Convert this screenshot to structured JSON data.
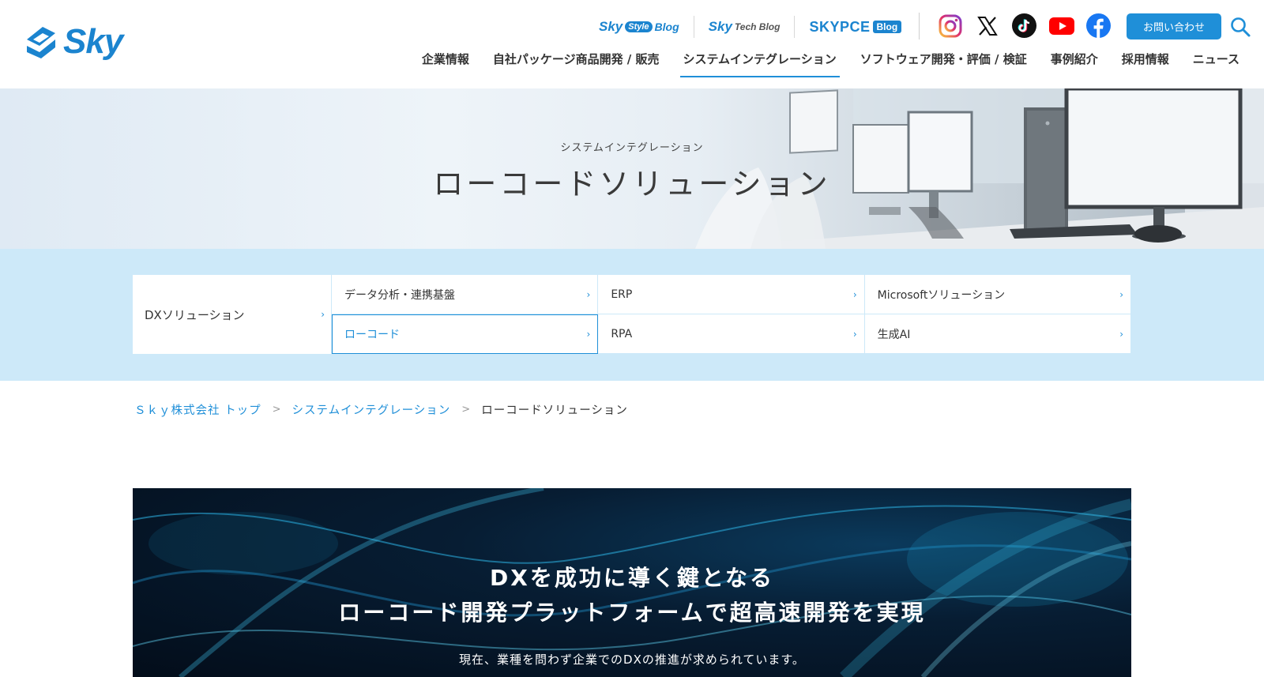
{
  "header": {
    "logo_text": "Sky",
    "blogs": [
      {
        "brand": "Sky",
        "pill": "Style",
        "suffix": "Blog"
      },
      {
        "brand": "Sky",
        "suffix": "Tech Blog"
      },
      {
        "brand": "SKYPCE",
        "pill": "Blog"
      }
    ],
    "social_icons": [
      "instagram-icon",
      "x-icon",
      "tiktok-icon",
      "youtube-icon",
      "facebook-icon"
    ],
    "contact_label": "お問い合わせ",
    "nav": [
      {
        "label": "企業情報"
      },
      {
        "label": "自社パッケージ商品開発 / 販売"
      },
      {
        "label": "システムインテグレーション",
        "active": true
      },
      {
        "label": "ソフトウェア開発・評価 / 検証"
      },
      {
        "label": "事例紹介"
      },
      {
        "label": "採用情報"
      },
      {
        "label": "ニュース"
      }
    ]
  },
  "hero": {
    "kicker": "システムインテグレーション",
    "title": "ローコードソリューション"
  },
  "subnav": {
    "lead": "DXソリューション",
    "items": [
      {
        "label": "データ分析・連携基盤"
      },
      {
        "label": "ERP"
      },
      {
        "label": "Microsoftソリューション"
      },
      {
        "label": "ローコード",
        "active": true
      },
      {
        "label": "RPA"
      },
      {
        "label": "生成AI"
      }
    ]
  },
  "breadcrumb": {
    "home": "Ｓｋｙ株式会社 トップ",
    "parent": "システムインテグレーション",
    "current": "ローコードソリューション"
  },
  "banner": {
    "line1": "DXを成功に導く鍵となる",
    "line2": "ローコード開発プラットフォームで超高速開発を実現",
    "lead": "現在、業種を問わず企業でのDXの推進が求められています。"
  },
  "colors": {
    "brand": "#1b84cf",
    "accent": "#1f8fd8",
    "subnav_band": "#cde9f9"
  }
}
